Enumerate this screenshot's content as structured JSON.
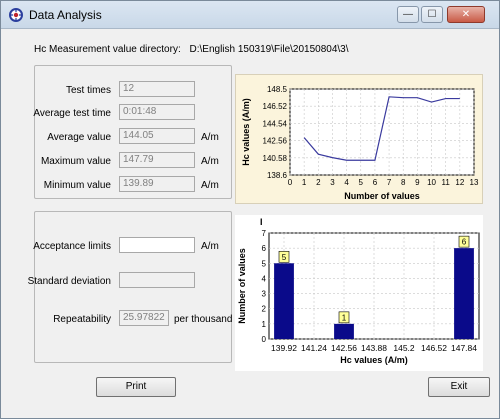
{
  "window": {
    "title": "Data Analysis",
    "minimize_glyph": "—",
    "maximize_glyph": "☐",
    "close_glyph": "✕"
  },
  "directory": {
    "label": "Hc Measurement value directory:",
    "path": "D:\\English 150319\\File\\20150804\\3\\"
  },
  "stats": {
    "test_times_label": "Test times",
    "test_times": "12",
    "avg_time_label": "Average test time",
    "avg_time": "0:01:48",
    "avg_value_label": "Average value",
    "avg_value": "144.05",
    "max_value_label": "Maximum value",
    "max_value": "147.79",
    "min_value_label": "Minimum value",
    "min_value": "139.89",
    "unit": "A/m"
  },
  "limits": {
    "acceptance_label": "Acceptance limits",
    "acceptance_value": "",
    "acceptance_unit": "A/m",
    "std_dev_label": "Standard deviation",
    "std_dev_value": "",
    "repeatability_label": "Repeatability",
    "repeatability_value": "25.97822",
    "repeatability_unit": "per thousand"
  },
  "chart_data": [
    {
      "type": "line",
      "xlabel": "Number of values",
      "ylabel": "Hc values (A/m)",
      "x_ticks": [
        "0",
        "1",
        "2",
        "3",
        "4",
        "5",
        "6",
        "7",
        "8",
        "9",
        "10",
        "11",
        "12",
        "13"
      ],
      "y_ticks": [
        "138.6",
        "140.58",
        "142.56",
        "144.54",
        "146.52",
        "148.5"
      ],
      "xlim": [
        0,
        13
      ],
      "ylim": [
        138.6,
        148.5
      ],
      "x": [
        1,
        2,
        3,
        4,
        5,
        6,
        7,
        8,
        9,
        10,
        11,
        12
      ],
      "y": [
        142.9,
        141.0,
        140.6,
        140.3,
        140.3,
        140.3,
        147.6,
        147.5,
        147.5,
        147.0,
        147.4,
        147.4
      ],
      "color": "#3a3a9e"
    },
    {
      "type": "bar",
      "xlabel": "Hc values (A/m)",
      "ylabel": "Number of values",
      "categories": [
        "139.92",
        "141.24",
        "142.56",
        "143.88",
        "145.2",
        "146.52",
        "147.84"
      ],
      "values": [
        5,
        0,
        1,
        0,
        0,
        0,
        6
      ],
      "value_labels": [
        "5",
        "",
        "1",
        "",
        "",
        "",
        "6"
      ],
      "y_ticks": [
        "0",
        "1",
        "2",
        "3",
        "4",
        "5",
        "6",
        "7"
      ],
      "ylim": [
        0,
        7
      ],
      "marker": "I",
      "bar_color": "#0a0a8a",
      "label_color": "#ffff99"
    }
  ],
  "buttons": {
    "print": "Print",
    "exit": "Exit"
  }
}
